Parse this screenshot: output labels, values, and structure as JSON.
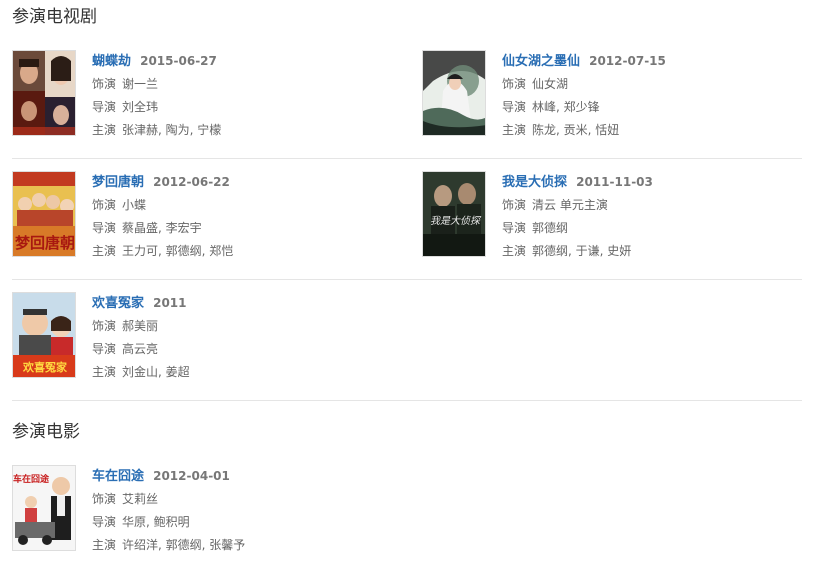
{
  "sections": {
    "tv": {
      "title": "参演电视剧"
    },
    "film": {
      "title": "参演电影"
    }
  },
  "labels": {
    "role": "饰演",
    "director": "导演",
    "cast": "主演"
  },
  "tv_shows": [
    {
      "title": "蝴蝶劫",
      "date": "2015-06-27",
      "role": "谢一兰",
      "director": "刘全玮",
      "cast": "张津赫, 陶为, 宁檬"
    },
    {
      "title": "仙女湖之墨仙",
      "date": "2012-07-15",
      "role": "仙女湖",
      "director": "林峰, 郑少锋",
      "cast": "陈龙, 贡米, 恬妞"
    },
    {
      "title": "梦回唐朝",
      "date": "2012-06-22",
      "role": "小蝶",
      "director": "蔡晶盛, 李宏宇",
      "cast": "王力可, 郭德纲, 郑恺"
    },
    {
      "title": "我是大侦探",
      "date": "2011-11-03",
      "role": "清云 单元主演",
      "director": "郭德纲",
      "cast": "郭德纲, 于谦, 史妍"
    },
    {
      "title": "欢喜冤家",
      "date": "2011",
      "role": "郝美丽",
      "director": "高云亮",
      "cast": "刘金山, 姜超"
    }
  ],
  "films": [
    {
      "title": "车在囧途",
      "date": "2012-04-01",
      "role": "艾莉丝",
      "director": "华原, 鲍积明",
      "cast": "许绍洋, 郭德纲, 张馨予"
    }
  ],
  "poster_texts": {
    "menghui": "梦回唐朝",
    "detective": "我是大侦探",
    "huanxi": "欢喜冤家",
    "chezai": "车在囧途"
  }
}
